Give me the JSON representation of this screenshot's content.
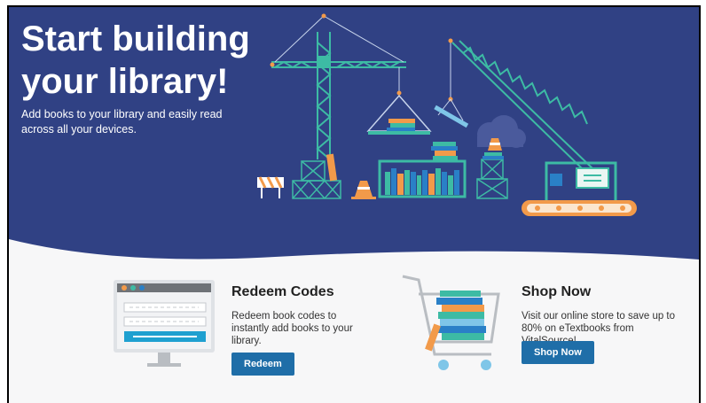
{
  "hero": {
    "title": "Start building your library!",
    "subtitle": "Add books to your library and easily read across all your devices.",
    "background_color": "#304184",
    "accent_teal": "#3dbba4",
    "accent_orange": "#f29a4a"
  },
  "cards": [
    {
      "icon": "computer-monitor-icon",
      "title": "Redeem Codes",
      "description": "Redeem book codes to instantly add books to your library.",
      "button_label": "Redeem"
    },
    {
      "icon": "shopping-cart-books-icon",
      "title": "Shop Now",
      "description": "Visit our online store to save up to 80% on eTextbooks from VitalSource!",
      "button_label": "Shop Now"
    }
  ],
  "button_color": "#1f6ea8"
}
